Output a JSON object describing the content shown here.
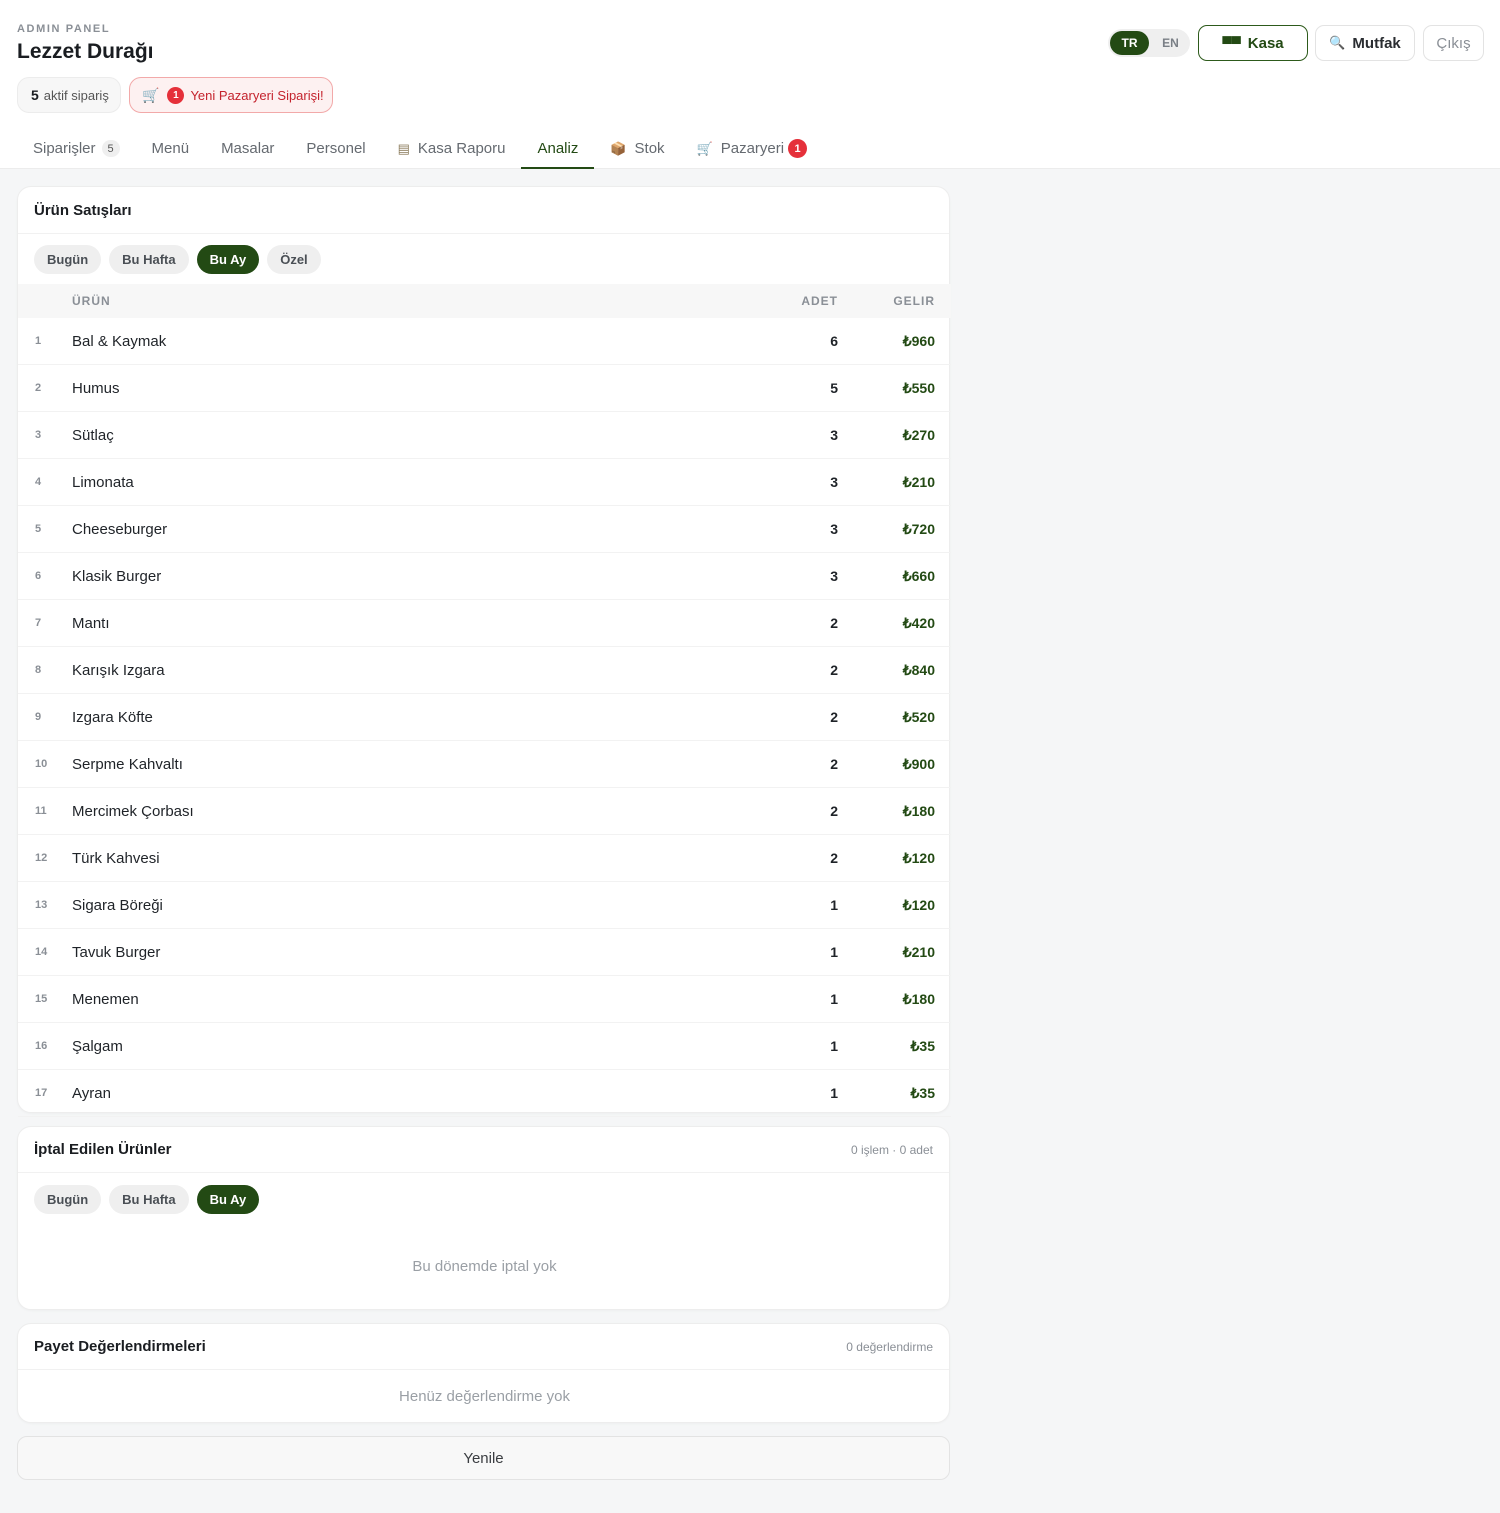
{
  "header": {
    "eyebrow": "ADMIN PANEL",
    "title": "Lezzet Durağı",
    "active_count": "5",
    "active_label": "aktif sipariş",
    "marketplace_alert": {
      "count": "1",
      "text": "Yeni Pazaryeri Siparişi!"
    },
    "lang": {
      "tr": "TR",
      "en": "EN",
      "selected": "TR"
    },
    "kasa_label": "Kasa",
    "mutfak_label": "Mutfak",
    "logout_label": "Çıkış"
  },
  "tabs": [
    {
      "label": "Siparişler",
      "count": "5"
    },
    {
      "label": "Menü"
    },
    {
      "label": "Masalar"
    },
    {
      "label": "Personel"
    },
    {
      "label": "Kasa Raporu"
    },
    {
      "label": "Analiz",
      "active": true
    },
    {
      "label": "Stok"
    },
    {
      "label": "Pazaryeri",
      "badge": "1"
    }
  ],
  "sales": {
    "title": "Ürün Satışları",
    "filters": [
      "Bugün",
      "Bu Hafta",
      "Bu Ay",
      "Özel"
    ],
    "active_filter": "Bu Ay",
    "columns": {
      "product": "ÜRÜN",
      "qty": "ADET",
      "revenue": "GELIR"
    },
    "rows": [
      {
        "idx": "1",
        "name": "Bal & Kaymak",
        "qty": "6",
        "revenue": "₺960"
      },
      {
        "idx": "2",
        "name": "Humus",
        "qty": "5",
        "revenue": "₺550"
      },
      {
        "idx": "3",
        "name": "Sütlaç",
        "qty": "3",
        "revenue": "₺270"
      },
      {
        "idx": "4",
        "name": "Limonata",
        "qty": "3",
        "revenue": "₺210"
      },
      {
        "idx": "5",
        "name": "Cheeseburger",
        "qty": "3",
        "revenue": "₺720"
      },
      {
        "idx": "6",
        "name": "Klasik Burger",
        "qty": "3",
        "revenue": "₺660"
      },
      {
        "idx": "7",
        "name": "Mantı",
        "qty": "2",
        "revenue": "₺420"
      },
      {
        "idx": "8",
        "name": "Karışık Izgara",
        "qty": "2",
        "revenue": "₺840"
      },
      {
        "idx": "9",
        "name": "Izgara Köfte",
        "qty": "2",
        "revenue": "₺520"
      },
      {
        "idx": "10",
        "name": "Serpme Kahvaltı",
        "qty": "2",
        "revenue": "₺900"
      },
      {
        "idx": "11",
        "name": "Mercimek Çorbası",
        "qty": "2",
        "revenue": "₺180"
      },
      {
        "idx": "12",
        "name": "Türk Kahvesi",
        "qty": "2",
        "revenue": "₺120"
      },
      {
        "idx": "13",
        "name": "Sigara Böreği",
        "qty": "1",
        "revenue": "₺120"
      },
      {
        "idx": "14",
        "name": "Tavuk Burger",
        "qty": "1",
        "revenue": "₺210"
      },
      {
        "idx": "15",
        "name": "Menemen",
        "qty": "1",
        "revenue": "₺180"
      },
      {
        "idx": "16",
        "name": "Şalgam",
        "qty": "1",
        "revenue": "₺35"
      },
      {
        "idx": "17",
        "name": "Ayran",
        "qty": "1",
        "revenue": "₺35"
      }
    ]
  },
  "cancelled": {
    "title": "İptal Edilen Ürünler",
    "meta": "0 işlem · 0 adet",
    "filters": [
      "Bugün",
      "Bu Hafta",
      "Bu Ay"
    ],
    "active_filter": "Bu Ay",
    "empty": "Bu dönemde iptal yok"
  },
  "ratings": {
    "title": "Payet Değerlendirmeleri",
    "meta": "0 değerlendirme",
    "empty": "Henüz değerlendirme yok"
  },
  "refresh_label": "Yenile",
  "colors": {
    "brand": "#234a14",
    "alert": "#e5303a"
  }
}
